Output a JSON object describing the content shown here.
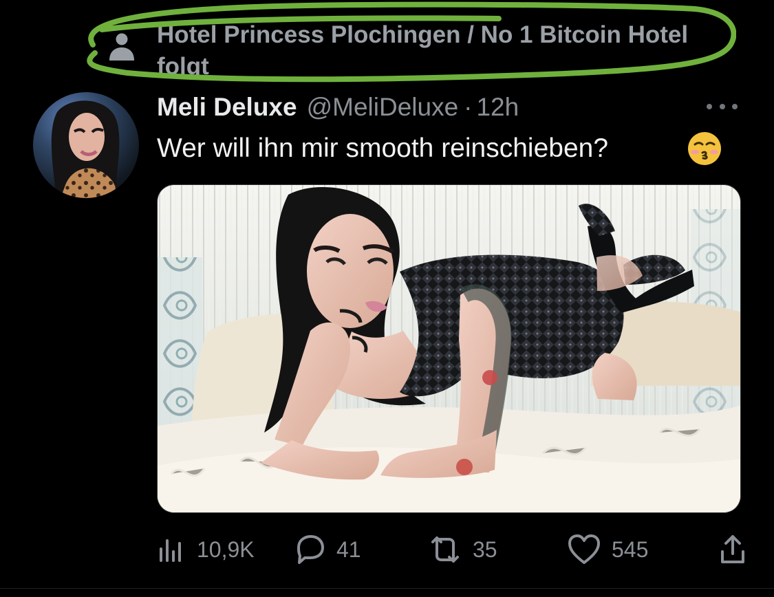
{
  "social_context": {
    "text": "Hotel Princess Plochingen / No 1 Bitcoin Hotel folgt",
    "icon": "person-icon"
  },
  "tweet": {
    "display_name": "Meli Deluxe",
    "handle": "@MeliDeluxe",
    "separator": "·",
    "time": "12h",
    "text": "Wer will ihn mir smooth reinschieben?",
    "emoji": "kissing-face-with-closed-eyes"
  },
  "actions": {
    "views": "10,9K",
    "replies": "41",
    "reposts": "35",
    "likes": "545"
  },
  "colors": {
    "background": "#000000",
    "primary_text": "#e7e9ea",
    "secondary_text": "#8b9096",
    "highlight": "#72b33f"
  }
}
